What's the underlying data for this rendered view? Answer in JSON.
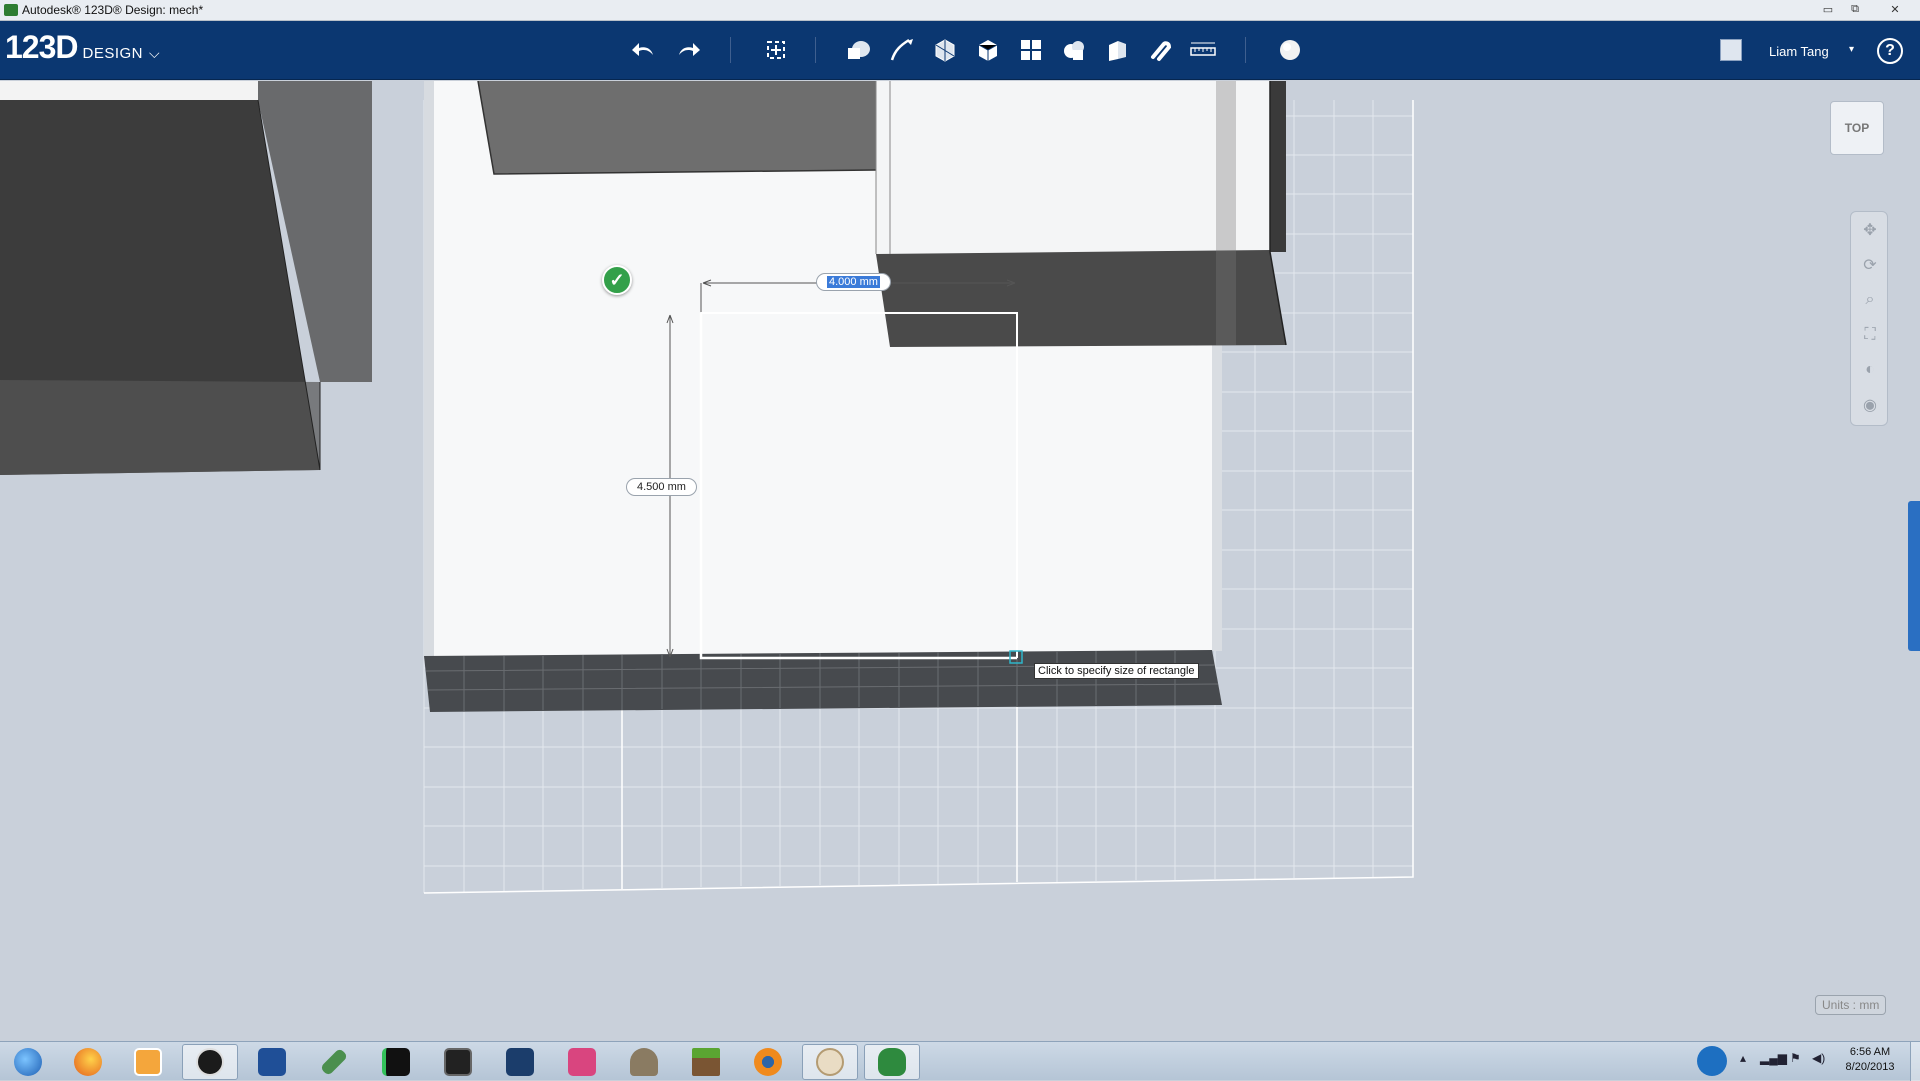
{
  "window": {
    "title": "Autodesk® 123D® Design: mech*",
    "minimize": "▭",
    "maximize": "⧉",
    "close": "✕"
  },
  "toolbar": {
    "brand_big": "123D",
    "brand_small": "DESIGN",
    "brand_chevron": "⌵",
    "tools": [
      "undo-icon",
      "redo-icon",
      "transform-icon",
      "primitives-icon",
      "sketch-icon",
      "construct-icon",
      "modify-icon",
      "pattern-icon",
      "grouping-icon",
      "combine-icon",
      "snap-icon",
      "measure-icon",
      "material-icon"
    ],
    "username": "Liam Tang",
    "user_dropdown": "▾",
    "help": "?"
  },
  "viewport": {
    "width_dimension": "4.000 mm",
    "height_dimension": "4.500 mm",
    "tooltip": "Click to specify size of rectangle",
    "check_mark": "✓",
    "viewcube_label": "TOP",
    "nav_tools": [
      "pan-icon",
      "orbit-icon",
      "zoom-icon",
      "fit-icon",
      "view-icon",
      "visibility-icon"
    ],
    "units": "Units : mm"
  },
  "taskbar": {
    "apps": [
      "start",
      "firefox",
      "media-player",
      "hp",
      "check-app",
      "pen-app",
      "s-app",
      "draw-app",
      "butterfly-app",
      "paint-app",
      "gimp",
      "minecraft",
      "blender",
      "paint-palette",
      "123d-design"
    ],
    "time": "6:56 AM",
    "date": "8/20/2013"
  },
  "colors": {
    "toolbar": "#0b3771",
    "viewport": "#c9d0da",
    "accent": "#2a6fc2"
  }
}
